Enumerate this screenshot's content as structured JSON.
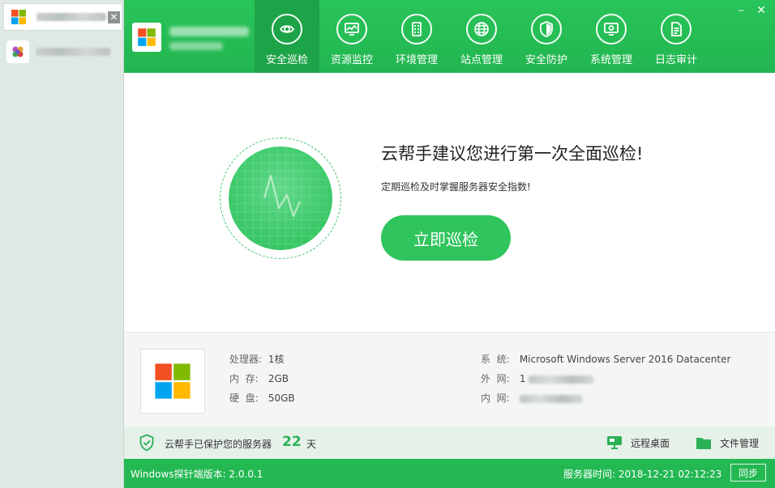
{
  "sidebar": {
    "items": [
      {
        "icon": "windows-logo-icon",
        "active": true
      },
      {
        "icon": "app-logo-icon",
        "active": false
      }
    ],
    "close_glyph": "✕"
  },
  "header": {
    "window_controls": {
      "minimize": "–",
      "close": "✕"
    },
    "nav": [
      {
        "label": "安全巡检",
        "icon": "eye-scan-icon",
        "active": true
      },
      {
        "label": "资源监控",
        "icon": "monitor-chart-icon",
        "active": false
      },
      {
        "label": "环境管理",
        "icon": "building-icon",
        "active": false
      },
      {
        "label": "站点管理",
        "icon": "globe-icon",
        "active": false
      },
      {
        "label": "安全防护",
        "icon": "shield-icon",
        "active": false
      },
      {
        "label": "系统管理",
        "icon": "settings-monitor-icon",
        "active": false
      },
      {
        "label": "日志审计",
        "icon": "document-icon",
        "active": false
      }
    ]
  },
  "hero": {
    "title": "云帮手建议您进行第一次全面巡检!",
    "subtitle": "定期巡检及时掌握服务器安全指数!",
    "button": "立即巡检"
  },
  "info": {
    "cpu_label": "处理器:",
    "cpu_value": "1核",
    "mem_label": "内  存:",
    "mem_value": "2GB",
    "disk_label": "硬  盘:",
    "disk_value": "50GB",
    "os_label": "系  统:",
    "os_value": "Microsoft Windows Server 2016 Datacenter",
    "wan_label": "外  网:",
    "wan_value": "1",
    "lan_label": "内  网:"
  },
  "status": {
    "protect_text": "云帮手已保护您的服务器",
    "days": "22",
    "days_unit": "天",
    "remote_desktop": "远程桌面",
    "file_manager": "文件管理"
  },
  "footer": {
    "version": "Windows探针端版本: 2.0.0.1",
    "server_time": "服务器时间: 2018-12-21 02:12:23",
    "sync_button": "同步"
  },
  "colors": {
    "brand_green": "#24b853",
    "active_nav": "#1ea448",
    "button_green": "#2fc45c"
  }
}
